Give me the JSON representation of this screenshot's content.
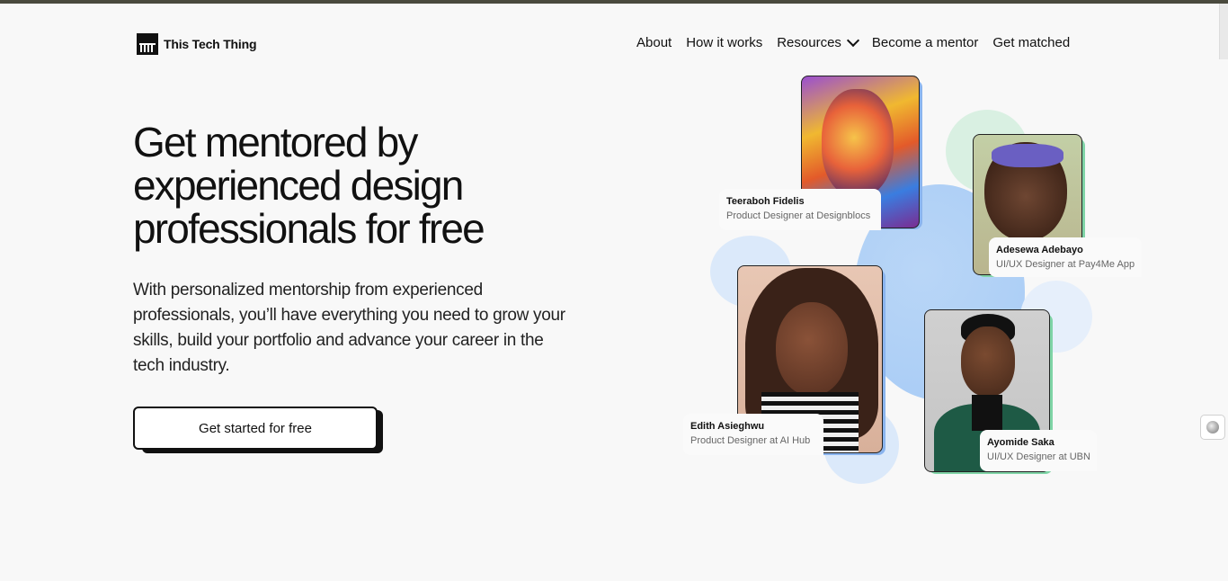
{
  "brand": {
    "name": "This Tech Thing"
  },
  "nav": {
    "about": "About",
    "how_it_works": "How it works",
    "resources": "Resources",
    "become_mentor": "Become a mentor",
    "get_matched": "Get matched"
  },
  "hero": {
    "headline": "Get mentored by experienced design professionals for free",
    "subtext": "With personalized mentorship from experienced professionals, you’ll have everything you need to grow your skills, build your portfolio and advance your career in the tech industry.",
    "cta": "Get started for free"
  },
  "mentors": [
    {
      "name": "Teeraboh Fidelis",
      "role": "Product Designer at Designblocs"
    },
    {
      "name": "Adesewa Adebayo",
      "role": "UI/UX Designer at Pay4Me App"
    },
    {
      "name": "Edith Asieghwu",
      "role": "Product Designer at AI Hub"
    },
    {
      "name": "Ayomide Saka",
      "role": "UI/UX Designer at UBN"
    }
  ],
  "colors": {
    "accent_blue": "#8ab4ee",
    "accent_green": "#7fd4a6",
    "text": "#111111",
    "background": "#f8f8f8"
  },
  "icons": {
    "resources_chevron": "chevron-down-icon",
    "side_widget": "widget-icon"
  }
}
